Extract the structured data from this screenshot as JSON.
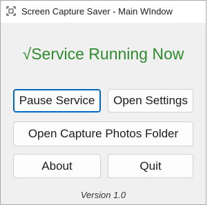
{
  "window": {
    "title": "Screen Capture Saver - Main WIndow",
    "icon": "capture-frame-icon"
  },
  "status": {
    "text": "√Service Running Now",
    "color": "#2e8b2e"
  },
  "buttons": {
    "pause": "Pause Service",
    "open_settings": "Open Settings",
    "open_folder": "Open Capture Photos Folder",
    "about": "About",
    "quit": "Quit"
  },
  "footer": {
    "version": "Version 1.0"
  },
  "colors": {
    "accent": "#0067c0",
    "window_bg": "#f0f0f0"
  }
}
